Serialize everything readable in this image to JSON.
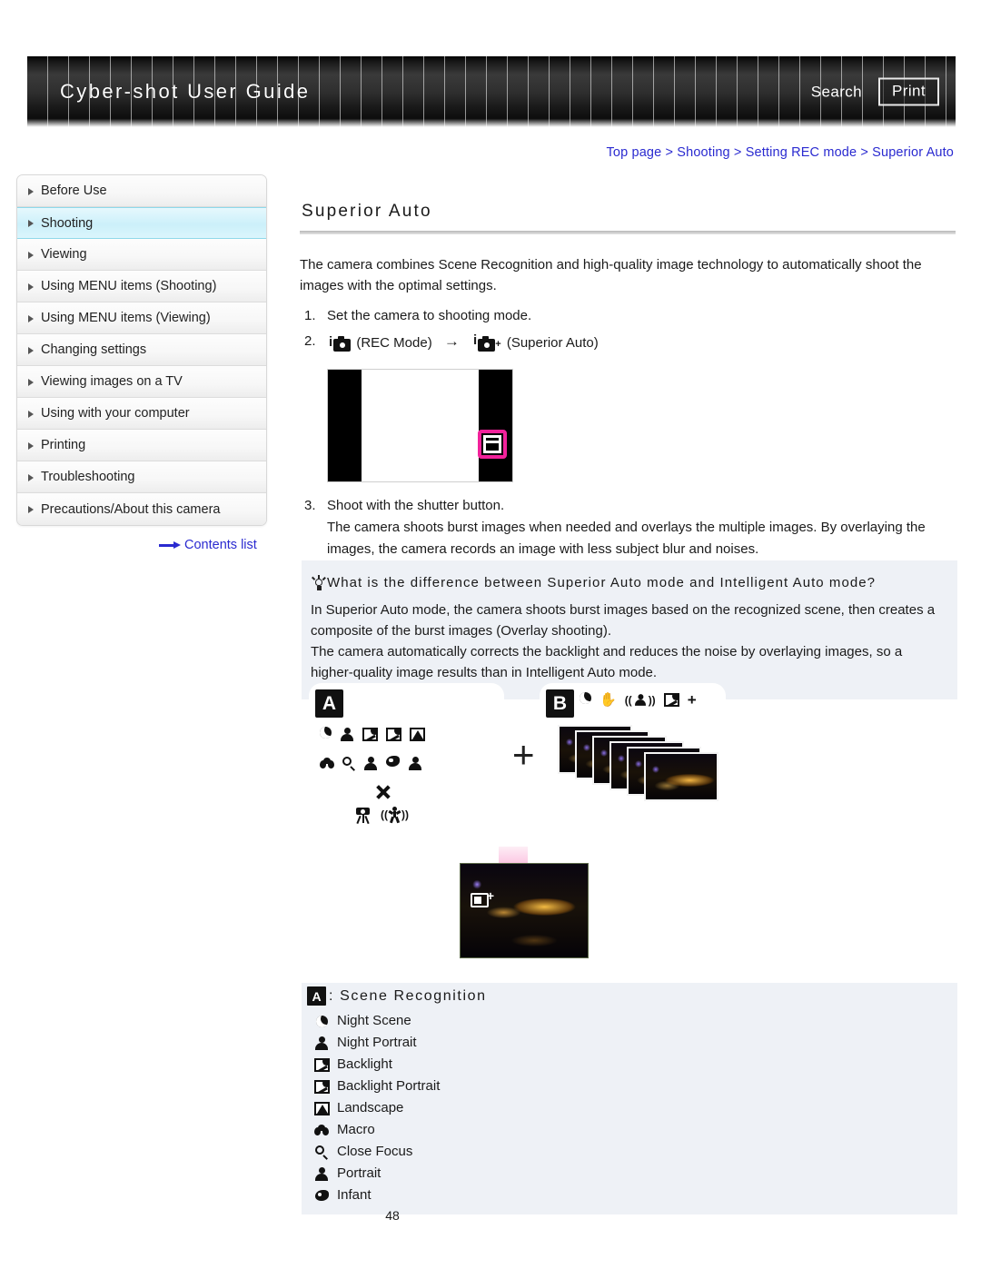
{
  "header": {
    "title": "Cyber-shot User Guide",
    "search_label": "Search",
    "print_label": "Print"
  },
  "breadcrumb": {
    "text": "Top page > Shooting > Setting REC mode > Superior Auto"
  },
  "sidebar": {
    "items": [
      {
        "label": "Before Use",
        "active": false
      },
      {
        "label": "Shooting",
        "active": true
      },
      {
        "label": "Viewing",
        "active": false
      },
      {
        "label": "Using MENU items (Shooting)",
        "active": false
      },
      {
        "label": "Using MENU items (Viewing)",
        "active": false
      },
      {
        "label": "Changing settings",
        "active": false
      },
      {
        "label": "Viewing images on a TV",
        "active": false
      },
      {
        "label": "Using with your computer",
        "active": false
      },
      {
        "label": "Printing",
        "active": false
      },
      {
        "label": "Troubleshooting",
        "active": false
      },
      {
        "label": "Precautions/About this camera",
        "active": false
      }
    ],
    "contents_link": "Contents list"
  },
  "main": {
    "title": "Superior Auto",
    "intro": "The camera combines Scene Recognition and high-quality image technology to automatically shoot the images with the optimal settings.",
    "steps": [
      {
        "num": "1.",
        "text": "Set the camera to shooting mode."
      },
      {
        "num": "2.",
        "icon1": "rec-mode-icon",
        "label1": "(REC Mode)",
        "arrow": "→",
        "icon2": "superior-auto-icon",
        "label2": "(Superior Auto)"
      },
      {
        "num": "3.",
        "text": "Shoot with the shutter button.",
        "detail": "The camera shoots burst images when needed and overlays the multiple images. By overlaying the images, the camera records an image with less subject blur and noises."
      }
    ]
  },
  "tip": {
    "heading": "What is the difference between Superior Auto mode and Intelligent Auto mode?",
    "paragraph1": "In Superior Auto mode, the camera shoots burst images based on the recognized scene, then creates a composite of the burst images (Overlay shooting).",
    "paragraph2": "The camera automatically corrects the backlight and reduces the noise by overlaying images, so a higher-quality image results than in Intelligent Auto mode."
  },
  "diagram": {
    "panel_a_badge": "A",
    "panel_b_badge": "B",
    "plus": "+",
    "burst_count": 6
  },
  "legend": {
    "badge": "A",
    "heading": ": Scene Recognition",
    "items": [
      {
        "icon": "moon-icon",
        "label": "Night Scene"
      },
      {
        "icon": "person-moon-icon",
        "label": "Night Portrait"
      },
      {
        "icon": "backlight-icon",
        "label": "Backlight"
      },
      {
        "icon": "backlight-portrait-icon",
        "label": "Backlight Portrait"
      },
      {
        "icon": "landscape-icon",
        "label": "Landscape"
      },
      {
        "icon": "flower-icon",
        "label": "Macro"
      },
      {
        "icon": "close-focus-icon",
        "label": "Close Focus"
      },
      {
        "icon": "portrait-icon",
        "label": "Portrait"
      },
      {
        "icon": "infant-icon",
        "label": "Infant"
      }
    ]
  },
  "footer": {
    "page_number": "48"
  },
  "colors": {
    "link": "#2a2ad0",
    "highlight": "#f2229b",
    "sidebar_active": "#ccf0fa",
    "tip_bg": "#eef1f6"
  }
}
